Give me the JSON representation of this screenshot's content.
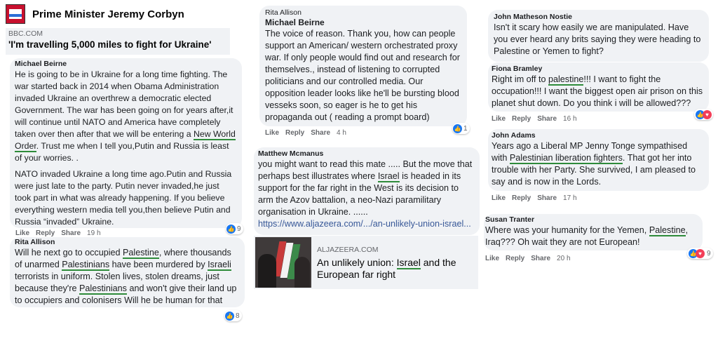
{
  "colors": {
    "bubble": "#f0f2f5",
    "like_blue": "#1877f2",
    "love_red": "#f33e58",
    "underline_green": "#2e8b3a",
    "link": "#385898"
  },
  "page": {
    "title": "Prime Minister Jeremy Corbyn"
  },
  "shared_link": {
    "domain": "BBC.COM",
    "headline": "'I'm travelling 5,000 miles to fight for Ukraine'"
  },
  "actions": {
    "like": "Like",
    "reply": "Reply",
    "share": "Share"
  },
  "col1": {
    "c1": {
      "name": "Michael Beirne",
      "p1": [
        "He is going to be in Ukraine for a long time fighting. The war started back in 2014 when Obama Administration invaded Ukraine an overthrew a democratic elected Government. The war has been going on for years after,it will continue until NATO and America have completely taken over then after that we will be entering a ",
        "New World Order",
        ". Trust me when I tell you,Putin and Russia is least of your worries. ."
      ],
      "p2": "NATO invaded Ukraine a long time ago.Putin and Russia were just late to the party. Putin never invaded,he just took part in what was already happening. If you believe everything western media tell you,then believe Putin and Russia “invaded” Ukraine.",
      "time": "19 h",
      "reactions": "9"
    },
    "c2": {
      "name": "Rita Allison",
      "t": [
        "Will he next go to occupied ",
        "Palestine",
        ", where thousands of unarmed ",
        "Palestinians",
        " have been murdered by ",
        "Israeli",
        " terrorists in uniform. Stolen lives, stolen dreams, just because they're ",
        "Palestinians",
        " and won't give their land up to occupiers and colonisers Will he be human for that"
      ],
      "reactions": "8"
    }
  },
  "col2": {
    "c1": {
      "reply_to": "Rita Allison",
      "name": "Michael Beirne",
      "text": "The voice of reason. Thank you, how can people support an American/ western orchestrated proxy war. If only people would find out and research for themselves., instead of listening to corrupted politicians and our controlled media. Our opposition leader looks like he'll be bursting blood vesseks soon, so eager is he to get his propaganda out ( reading a prompt board)",
      "time": "4 h",
      "reactions": "1"
    },
    "c2": {
      "name": "Matthew Mcmanus",
      "t": [
        "you might want to read this mate ..... But the move that perhaps best illustrates where ",
        "Israel",
        " is headed in its support for the far right in the West is its decision to arm the Azov battalion, a neo-Nazi paramilitary organisation in Ukraine. ...... "
      ],
      "link_text": "https://www.aljazeera.com/.../an-unlikely-union-israel...",
      "card": {
        "domain": "ALJAZEERA.COM",
        "title": [
          "An unlikely union: ",
          "Israel",
          " and the European far right"
        ]
      }
    }
  },
  "col3": {
    "c1": {
      "name": "John Matheson Nostie",
      "text": "Isn't it scary how easily we are manipulated. Have you ever heard any brits saying they were heading to Palestine or Yemen to fight?"
    },
    "c2": {
      "name": "Fiona Bramley",
      "t": [
        "Right im off to ",
        "palestine",
        "!!! I want to fight the occupation!!! I want the biggest open air prison on this planet shut down. Do you think i will be allowed???"
      ],
      "time": "16 h"
    },
    "c3": {
      "name": "John Adams",
      "t": [
        "Years ago a Liberal MP Jenny Tonge sympathised with ",
        "Palestinian liberation fighters",
        ". That got her into trouble with her Party. She survived, I am pleased to say and is now in the Lords."
      ],
      "time": "17 h"
    },
    "c4": {
      "name": "Susan Tranter",
      "t": [
        "Where was your humanity for the Yemen, ",
        "Palestine",
        ", Iraq??? Oh wait they are not European!"
      ],
      "time": "20 h",
      "reactions": "9"
    }
  }
}
